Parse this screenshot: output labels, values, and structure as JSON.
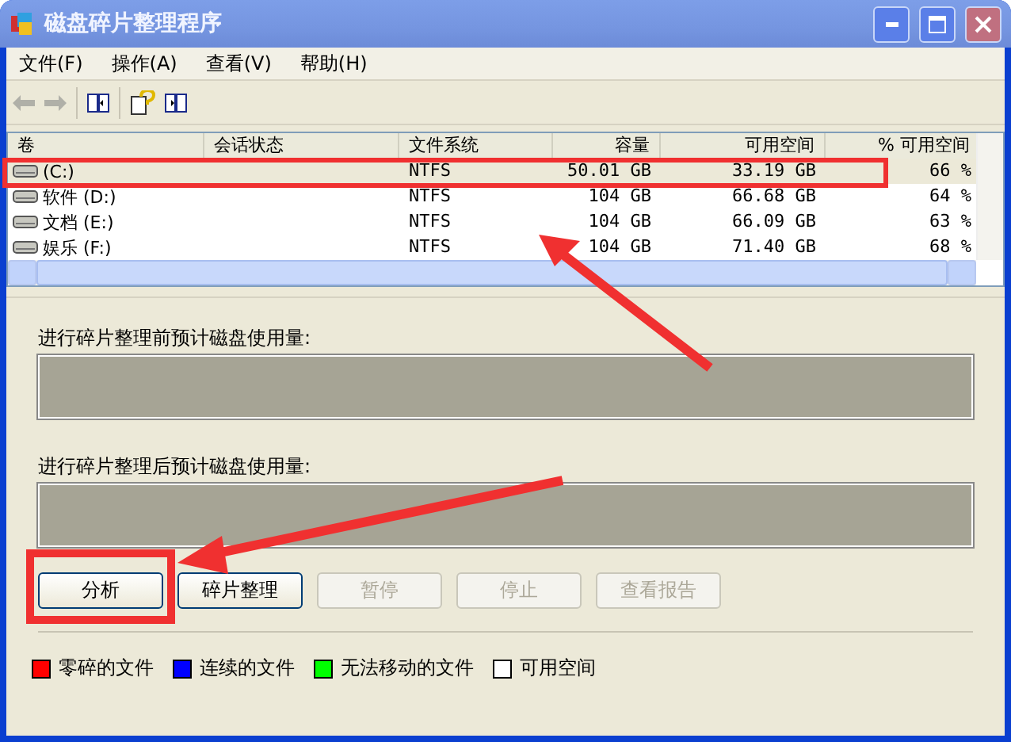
{
  "window": {
    "title": "磁盘碎片整理程序"
  },
  "menu": [
    "文件(F)",
    "操作(A)",
    "查看(V)",
    "帮助(H)"
  ],
  "volumes": {
    "columns": [
      "卷",
      "会话状态",
      "文件系统",
      "容量",
      "可用空间",
      "% 可用空间"
    ],
    "rows": [
      {
        "volume": "(C:)",
        "file_system": "NTFS",
        "capacity": "50.01 GB",
        "free": "33.19 GB",
        "free_pct": "66 %",
        "selected": true
      },
      {
        "volume": "软件 (D:)",
        "file_system": "NTFS",
        "capacity": "104 GB",
        "free": "66.68 GB",
        "free_pct": "64 %",
        "selected": false
      },
      {
        "volume": "文档 (E:)",
        "file_system": "NTFS",
        "capacity": "104 GB",
        "free": "66.09 GB",
        "free_pct": "63 %",
        "selected": false
      },
      {
        "volume": "娱乐 (F:)",
        "file_system": "NTFS",
        "capacity": "104 GB",
        "free": "71.40 GB",
        "free_pct": "68 %",
        "selected": false
      }
    ]
  },
  "before_label": "进行碎片整理前预计磁盘使用量:",
  "after_label": "进行碎片整理后预计磁盘使用量:",
  "buttons": [
    {
      "label": "分析",
      "disabled": false
    },
    {
      "label": "碎片整理",
      "disabled": false
    },
    {
      "label": "暂停",
      "disabled": true
    },
    {
      "label": "停止",
      "disabled": true
    },
    {
      "label": "查看报告",
      "disabled": true
    }
  ],
  "legend": [
    {
      "label": "零碎的文件",
      "color": "#ff0000"
    },
    {
      "label": "连续的文件",
      "color": "#0000ff"
    },
    {
      "label": "无法移动的文件",
      "color": "#00ff00"
    },
    {
      "label": "可用空间",
      "color": "#ffffff"
    }
  ]
}
